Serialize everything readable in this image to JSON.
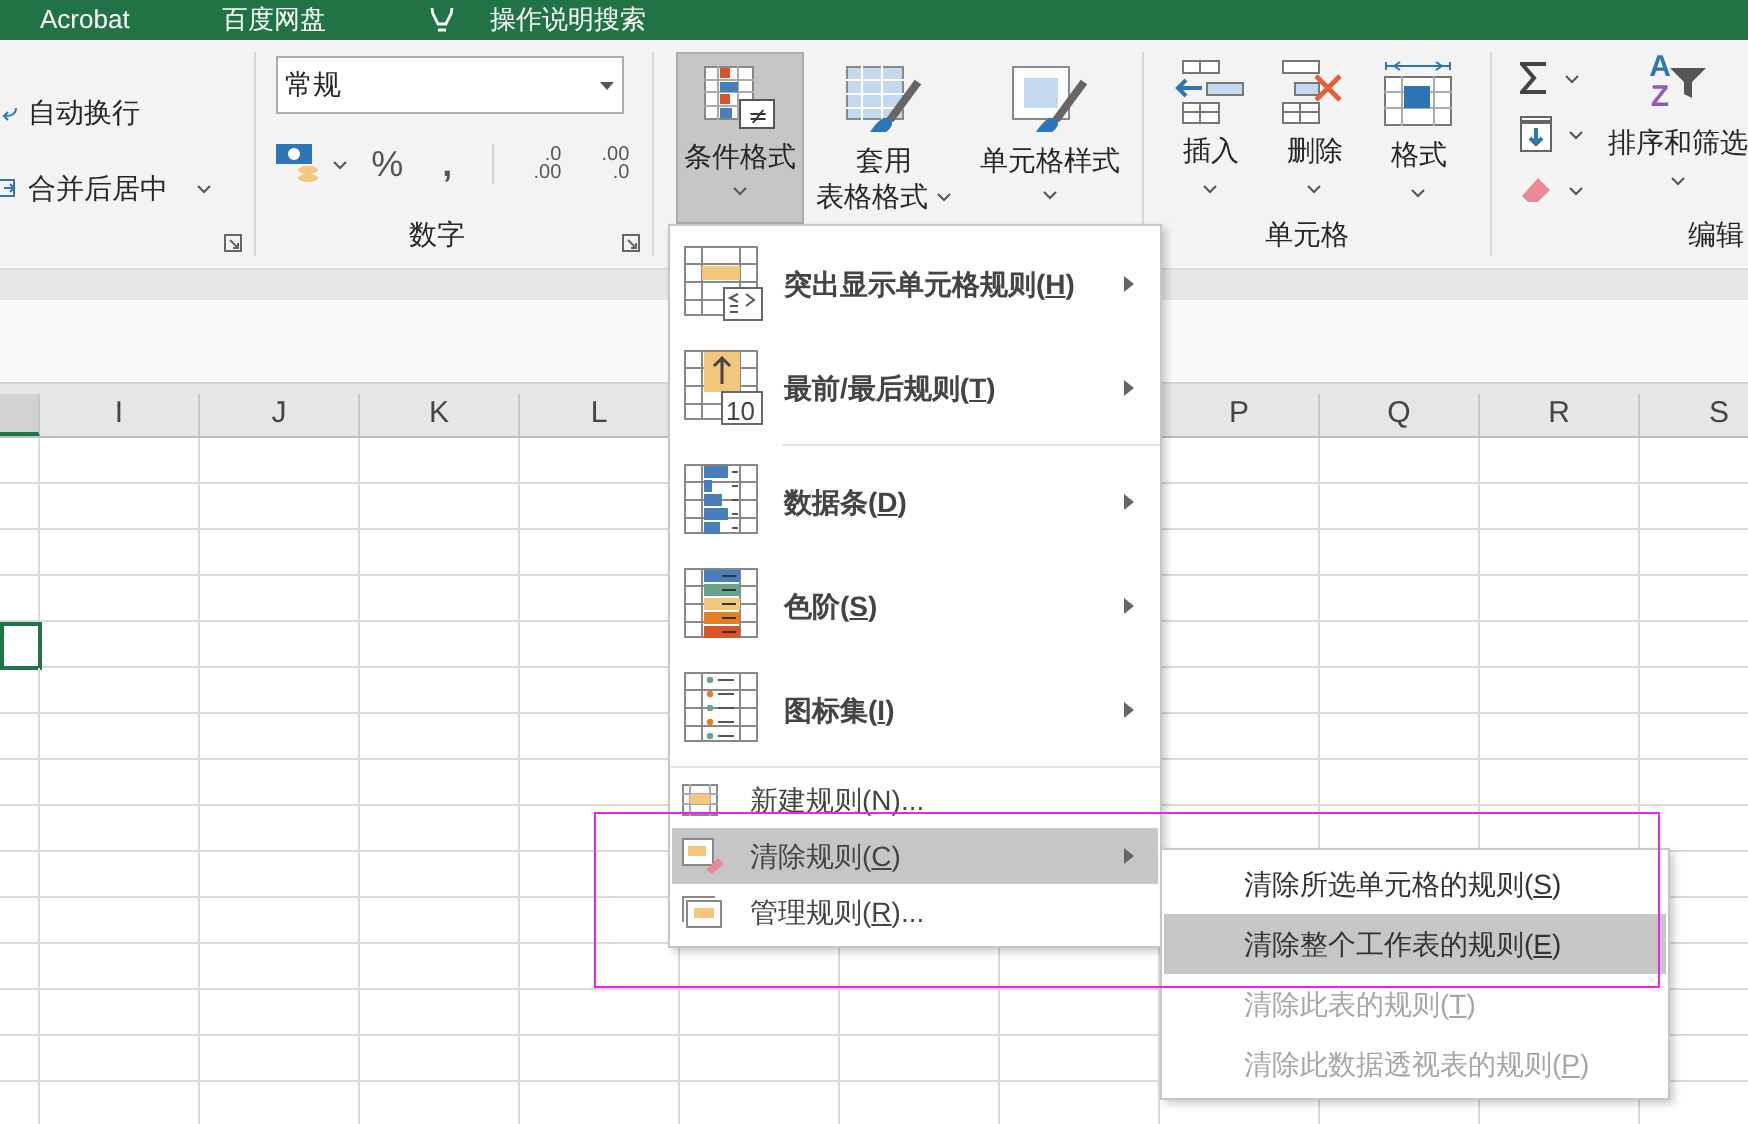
{
  "title_bar": {
    "items": [
      {
        "label": "Acrobat",
        "kind": "text"
      },
      {
        "label": "百度网盘",
        "kind": "text"
      },
      {
        "label": "操作说明搜索",
        "kind": "search"
      }
    ]
  },
  "ribbon": {
    "alignment": {
      "buttons": [
        {
          "label": "自动换行",
          "has_menu": false
        },
        {
          "label": "合并后居中",
          "has_menu": true
        }
      ]
    },
    "number": {
      "format": "常规",
      "percent": "%",
      "comma": ",",
      "increase_decimal": [
        ".0",
        ".00"
      ],
      "decrease_decimal": [
        ".00",
        ".0"
      ],
      "label": "数字"
    },
    "styles": {
      "buttons": [
        {
          "lines": [
            "条件格式"
          ],
          "pressed": true,
          "badge": "≠"
        },
        {
          "lines": [
            "套用",
            "表格格式"
          ],
          "pressed": false
        },
        {
          "lines": [
            "单元格样式"
          ],
          "pressed": false
        }
      ]
    },
    "cells": {
      "buttons": [
        {
          "label": "插入"
        },
        {
          "label": "删除"
        },
        {
          "label": "格式"
        }
      ],
      "label": "单元格"
    },
    "editing": {
      "sort": {
        "label": "排序和筛选",
        "letters": [
          "A",
          "Z"
        ]
      },
      "label": "编辑"
    }
  },
  "sheet": {
    "columns_left": [
      {
        "label": "I"
      },
      {
        "label": "J"
      },
      {
        "label": "K"
      },
      {
        "label": "L"
      }
    ],
    "columns_right": [
      {
        "label": "P"
      },
      {
        "label": "Q"
      },
      {
        "label": "R"
      },
      {
        "label": "S"
      }
    ],
    "rows": [
      {
        "selected": false
      },
      {
        "selected": false
      },
      {
        "selected": false
      },
      {
        "selected": false
      },
      {
        "selected": true
      },
      {
        "selected": false
      },
      {
        "selected": false
      },
      {
        "selected": false
      },
      {
        "selected": false
      },
      {
        "selected": false
      },
      {
        "selected": false
      },
      {
        "selected": false
      },
      {
        "selected": false
      },
      {
        "selected": false
      },
      {
        "selected": false
      }
    ]
  },
  "menu": {
    "items": [
      {
        "kind": "large",
        "label": "突出显示单元格规则(",
        "key": "H",
        "tail": ")",
        "submenu": true,
        "selected": false
      },
      {
        "kind": "large",
        "label": "最前/最后规则(",
        "key": "T",
        "tail": ")",
        "submenu": true,
        "selected": false,
        "badge": "10"
      },
      {
        "kind": "large",
        "label": "数据条(",
        "key": "D",
        "tail": ")",
        "submenu": true,
        "selected": false
      },
      {
        "kind": "large",
        "label": "色阶(",
        "key": "S",
        "tail": ")",
        "submenu": true,
        "selected": false
      },
      {
        "kind": "large",
        "label": "图标集(",
        "key": "I",
        "tail": ")",
        "submenu": true,
        "selected": false
      },
      {
        "kind": "small",
        "label": "新建规则(",
        "key": "N",
        "tail": ")...",
        "submenu": false,
        "selected": false
      },
      {
        "kind": "small",
        "label": "清除规则(",
        "key": "C",
        "tail": ")",
        "submenu": true,
        "selected": true
      },
      {
        "kind": "small",
        "label": "管理规则(",
        "key": "R",
        "tail": ")...",
        "submenu": false,
        "selected": false
      }
    ]
  },
  "submenu": {
    "items": [
      {
        "label": "清除所选单元格的规则(",
        "key": "S",
        "tail": ")",
        "selected": false,
        "disabled": false
      },
      {
        "label": "清除整个工作表的规则(",
        "key": "E",
        "tail": ")",
        "selected": true,
        "disabled": false
      },
      {
        "label": "清除此表的规则(",
        "key": "T",
        "tail": ")",
        "selected": false,
        "disabled": true
      },
      {
        "label": "清除此数据透视表的规则(",
        "key": "P",
        "tail": ")",
        "selected": false,
        "disabled": true
      }
    ]
  }
}
